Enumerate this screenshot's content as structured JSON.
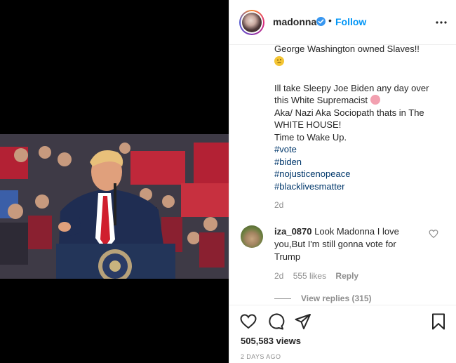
{
  "post": {
    "username": "madonna",
    "dot": "•",
    "follow_label": "Follow",
    "caption_lines": [
      {
        "text": "George Washington owned Slaves!!",
        "type": "text"
      },
      {
        "text": "",
        "type": "emoji-think"
      },
      {
        "text": "",
        "type": "blank"
      },
      {
        "text": "Ill take Sleepy Joe Biden any day over",
        "type": "text"
      },
      {
        "text": "this White Supremacist",
        "type": "text-pig"
      },
      {
        "text": "Aka/ Nazi Aka Sociopath thats in The",
        "type": "text"
      },
      {
        "text": "WHITE HOUSE!",
        "type": "text"
      },
      {
        "text": "Time to Wake Up.",
        "type": "text"
      },
      {
        "text": "#vote",
        "type": "hashtag"
      },
      {
        "text": "#biden",
        "type": "hashtag"
      },
      {
        "text": "#nojusticenopeace",
        "type": "hashtag"
      },
      {
        "text": "#blacklivesmatter",
        "type": "hashtag"
      }
    ],
    "caption_time": "2d",
    "comment": {
      "username": "iza_0870",
      "text": "Look Madonna I love you,But I'm still gonna vote for Trump",
      "time": "2d",
      "likes": "555 likes",
      "reply_label": "Reply",
      "view_replies": "View replies (315)"
    },
    "views": "505,583 views",
    "posted_ago": "2 DAYS AGO"
  },
  "icons": [
    "verified-badge-icon",
    "more-options-icon",
    "heart-icon",
    "comment-icon",
    "share-icon",
    "bookmark-icon"
  ],
  "colors": {
    "link": "#0095f6",
    "hashtag": "#00376b",
    "muted": "#8e8e8e",
    "verified": "#3897f0"
  }
}
